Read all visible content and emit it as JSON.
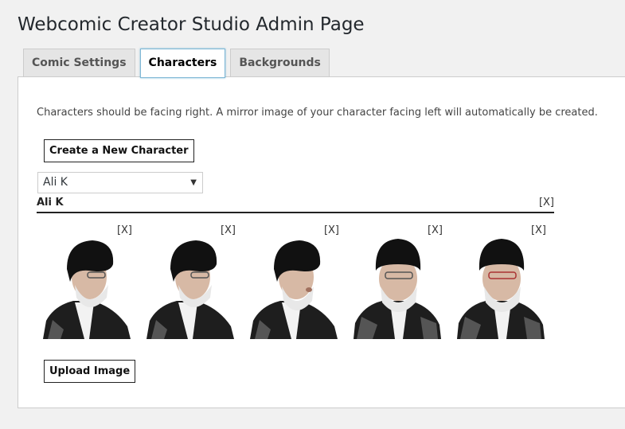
{
  "page": {
    "title": "Webcomic Creator Studio Admin Page"
  },
  "tabs": [
    {
      "label": "Comic Settings",
      "active": false
    },
    {
      "label": "Characters",
      "active": true
    },
    {
      "label": "Backgrounds",
      "active": false
    }
  ],
  "characters_panel": {
    "intro": "Characters should be facing right. A mirror image of your character facing left will automatically be created.",
    "create_button_label": "Create a New Character",
    "select": {
      "selected": "Ali K",
      "arrow": "▼"
    },
    "character": {
      "name": "Ali K",
      "delete_label": "[X]",
      "frames": [
        {
          "delete_label": "[X]",
          "image_icon": "character-frame-1"
        },
        {
          "delete_label": "[X]",
          "image_icon": "character-frame-2"
        },
        {
          "delete_label": "[X]",
          "image_icon": "character-frame-3"
        },
        {
          "delete_label": "[X]",
          "image_icon": "character-frame-4"
        },
        {
          "delete_label": "[X]",
          "image_icon": "character-frame-5"
        }
      ]
    },
    "upload_button_label": "Upload Image"
  },
  "colors": {
    "background": "#f1f1f1",
    "panel": "#ffffff",
    "active_tab_border": "#7fb8d6"
  }
}
